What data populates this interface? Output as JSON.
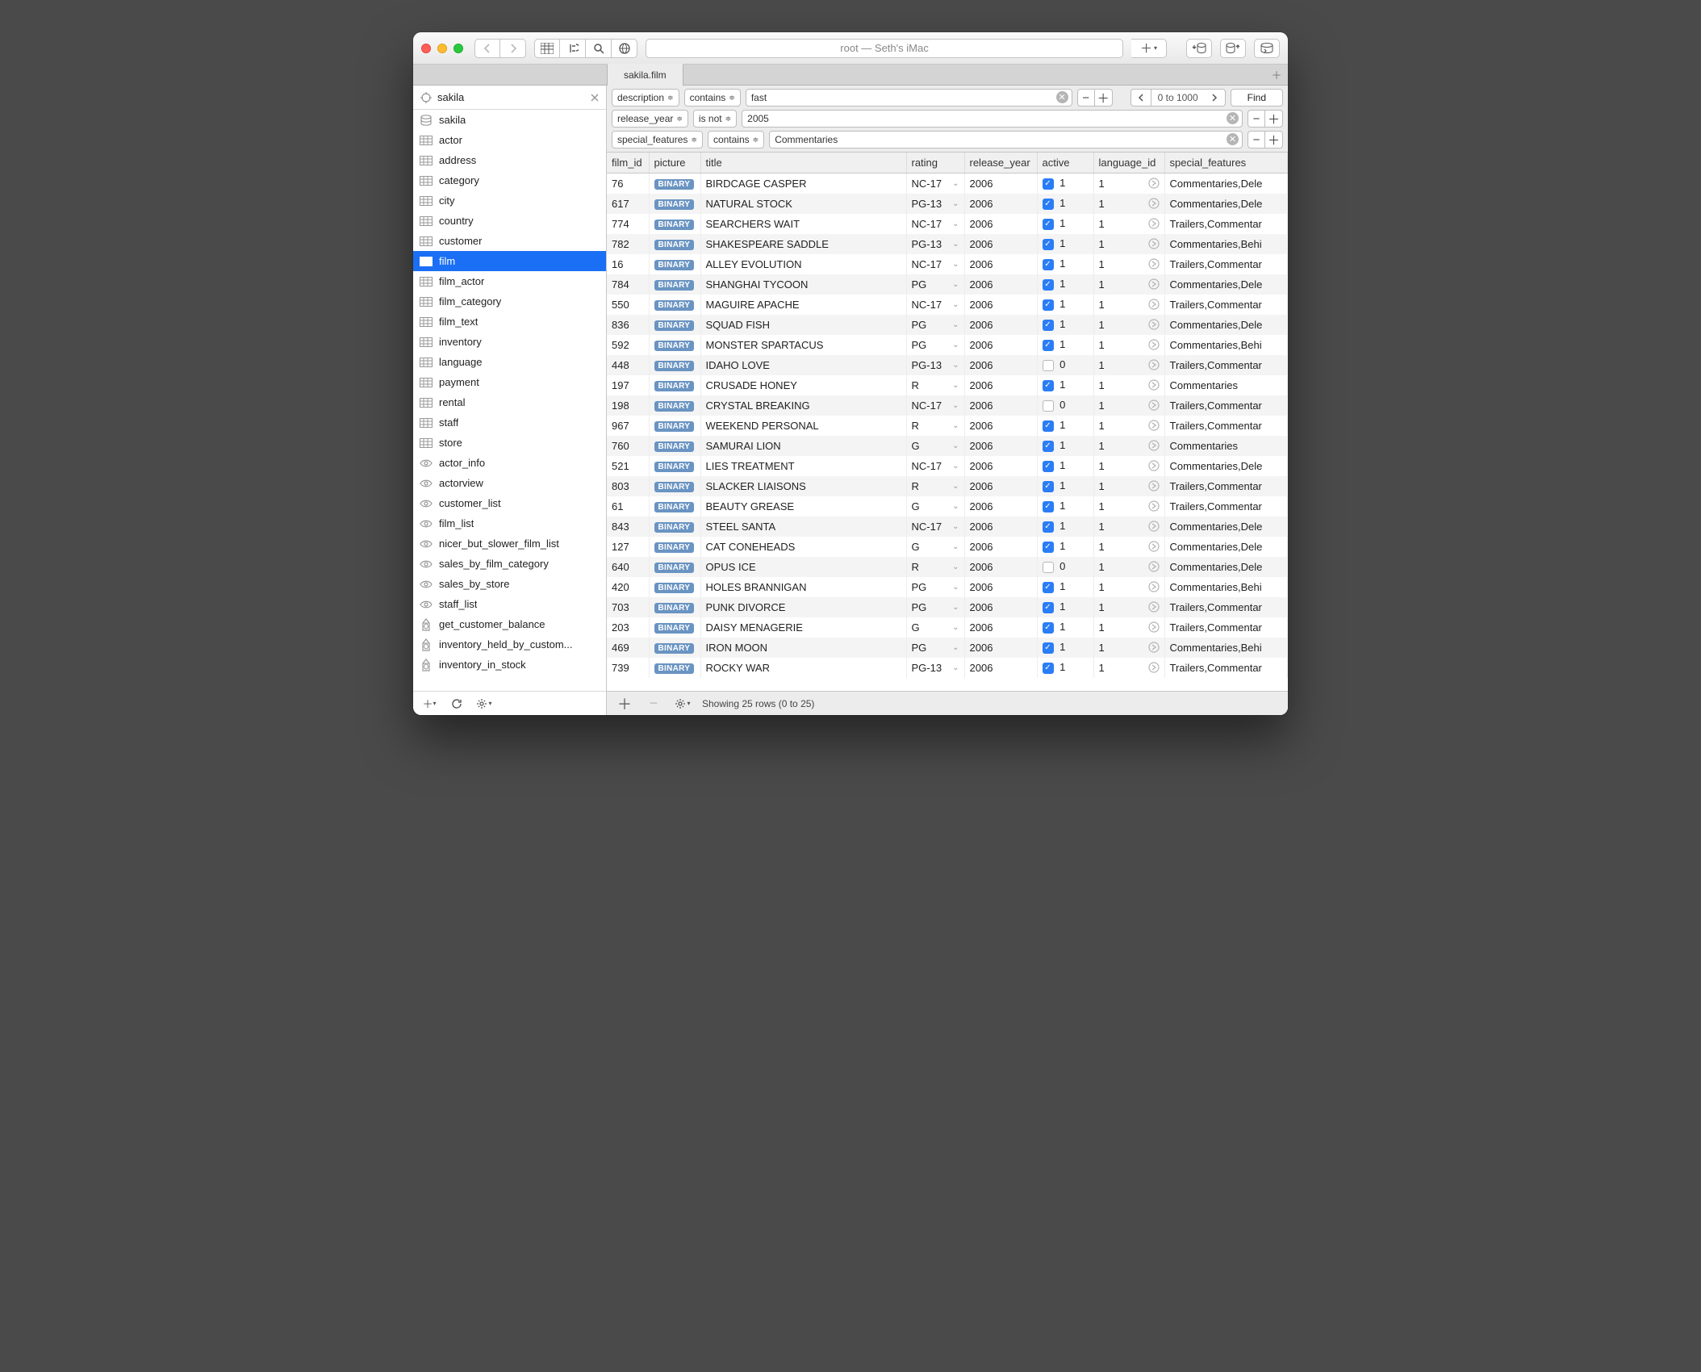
{
  "titlebar": {
    "title": "root — Seth's iMac"
  },
  "tab": {
    "label": "sakila.film"
  },
  "sidebar": {
    "search": "sakila",
    "items": [
      {
        "icon": "db",
        "label": "sakila"
      },
      {
        "icon": "table",
        "label": "actor"
      },
      {
        "icon": "table",
        "label": "address"
      },
      {
        "icon": "table",
        "label": "category"
      },
      {
        "icon": "table",
        "label": "city"
      },
      {
        "icon": "table",
        "label": "country"
      },
      {
        "icon": "table",
        "label": "customer"
      },
      {
        "icon": "table",
        "label": "film",
        "selected": true
      },
      {
        "icon": "table",
        "label": "film_actor"
      },
      {
        "icon": "table",
        "label": "film_category"
      },
      {
        "icon": "table",
        "label": "film_text"
      },
      {
        "icon": "table",
        "label": "inventory"
      },
      {
        "icon": "table",
        "label": "language"
      },
      {
        "icon": "table",
        "label": "payment"
      },
      {
        "icon": "table",
        "label": "rental"
      },
      {
        "icon": "table",
        "label": "staff"
      },
      {
        "icon": "table",
        "label": "store"
      },
      {
        "icon": "view",
        "label": "actor_info"
      },
      {
        "icon": "view",
        "label": "actorview"
      },
      {
        "icon": "view",
        "label": "customer_list"
      },
      {
        "icon": "view",
        "label": "film_list"
      },
      {
        "icon": "view",
        "label": "nicer_but_slower_film_list"
      },
      {
        "icon": "view",
        "label": "sales_by_film_category"
      },
      {
        "icon": "view",
        "label": "sales_by_store"
      },
      {
        "icon": "view",
        "label": "staff_list"
      },
      {
        "icon": "func",
        "label": "get_customer_balance"
      },
      {
        "icon": "func",
        "label": "inventory_held_by_custom..."
      },
      {
        "icon": "func",
        "label": "inventory_in_stock"
      }
    ]
  },
  "filters": [
    {
      "field": "description",
      "op": "contains",
      "value": "fast"
    },
    {
      "field": "release_year",
      "op": "is not",
      "value": "2005"
    },
    {
      "field": "special_features",
      "op": "contains",
      "value": "Commentaries"
    }
  ],
  "pager": {
    "range": "0 to 1000",
    "find_label": "Find"
  },
  "picture_label": "BINARY",
  "columns": [
    "film_id",
    "picture",
    "title",
    "rating",
    "release_year",
    "active",
    "language_id",
    "special_features"
  ],
  "rows": [
    {
      "film_id": "76",
      "title": "BIRDCAGE CASPER",
      "rating": "NC-17",
      "release_year": "2006",
      "active": true,
      "active_val": "1",
      "language_id": "1",
      "special_features": "Commentaries,Dele"
    },
    {
      "film_id": "617",
      "title": "NATURAL STOCK",
      "rating": "PG-13",
      "release_year": "2006",
      "active": true,
      "active_val": "1",
      "language_id": "1",
      "special_features": "Commentaries,Dele"
    },
    {
      "film_id": "774",
      "title": "SEARCHERS WAIT",
      "rating": "NC-17",
      "release_year": "2006",
      "active": true,
      "active_val": "1",
      "language_id": "1",
      "special_features": "Trailers,Commentar"
    },
    {
      "film_id": "782",
      "title": "SHAKESPEARE SADDLE",
      "rating": "PG-13",
      "release_year": "2006",
      "active": true,
      "active_val": "1",
      "language_id": "1",
      "special_features": "Commentaries,Behi"
    },
    {
      "film_id": "16",
      "title": "ALLEY EVOLUTION",
      "rating": "NC-17",
      "release_year": "2006",
      "active": true,
      "active_val": "1",
      "language_id": "1",
      "special_features": "Trailers,Commentar"
    },
    {
      "film_id": "784",
      "title": "SHANGHAI TYCOON",
      "rating": "PG",
      "release_year": "2006",
      "active": true,
      "active_val": "1",
      "language_id": "1",
      "special_features": "Commentaries,Dele"
    },
    {
      "film_id": "550",
      "title": "MAGUIRE APACHE",
      "rating": "NC-17",
      "release_year": "2006",
      "active": true,
      "active_val": "1",
      "language_id": "1",
      "special_features": "Trailers,Commentar"
    },
    {
      "film_id": "836",
      "title": "SQUAD FISH",
      "rating": "PG",
      "release_year": "2006",
      "active": true,
      "active_val": "1",
      "language_id": "1",
      "special_features": "Commentaries,Dele"
    },
    {
      "film_id": "592",
      "title": "MONSTER SPARTACUS",
      "rating": "PG",
      "release_year": "2006",
      "active": true,
      "active_val": "1",
      "language_id": "1",
      "special_features": "Commentaries,Behi"
    },
    {
      "film_id": "448",
      "title": "IDAHO LOVE",
      "rating": "PG-13",
      "release_year": "2006",
      "active": false,
      "active_val": "0",
      "language_id": "1",
      "special_features": "Trailers,Commentar"
    },
    {
      "film_id": "197",
      "title": "CRUSADE HONEY",
      "rating": "R",
      "release_year": "2006",
      "active": true,
      "active_val": "1",
      "language_id": "1",
      "special_features": "Commentaries"
    },
    {
      "film_id": "198",
      "title": "CRYSTAL BREAKING",
      "rating": "NC-17",
      "release_year": "2006",
      "active": false,
      "active_val": "0",
      "language_id": "1",
      "special_features": "Trailers,Commentar"
    },
    {
      "film_id": "967",
      "title": "WEEKEND PERSONAL",
      "rating": "R",
      "release_year": "2006",
      "active": true,
      "active_val": "1",
      "language_id": "1",
      "special_features": "Trailers,Commentar"
    },
    {
      "film_id": "760",
      "title": "SAMURAI LION",
      "rating": "G",
      "release_year": "2006",
      "active": true,
      "active_val": "1",
      "language_id": "1",
      "special_features": "Commentaries"
    },
    {
      "film_id": "521",
      "title": "LIES TREATMENT",
      "rating": "NC-17",
      "release_year": "2006",
      "active": true,
      "active_val": "1",
      "language_id": "1",
      "special_features": "Commentaries,Dele"
    },
    {
      "film_id": "803",
      "title": "SLACKER LIAISONS",
      "rating": "R",
      "release_year": "2006",
      "active": true,
      "active_val": "1",
      "language_id": "1",
      "special_features": "Trailers,Commentar"
    },
    {
      "film_id": "61",
      "title": "BEAUTY GREASE",
      "rating": "G",
      "release_year": "2006",
      "active": true,
      "active_val": "1",
      "language_id": "1",
      "special_features": "Trailers,Commentar"
    },
    {
      "film_id": "843",
      "title": "STEEL SANTA",
      "rating": "NC-17",
      "release_year": "2006",
      "active": true,
      "active_val": "1",
      "language_id": "1",
      "special_features": "Commentaries,Dele"
    },
    {
      "film_id": "127",
      "title": "CAT CONEHEADS",
      "rating": "G",
      "release_year": "2006",
      "active": true,
      "active_val": "1",
      "language_id": "1",
      "special_features": "Commentaries,Dele"
    },
    {
      "film_id": "640",
      "title": "OPUS ICE",
      "rating": "R",
      "release_year": "2006",
      "active": false,
      "active_val": "0",
      "language_id": "1",
      "special_features": "Commentaries,Dele"
    },
    {
      "film_id": "420",
      "title": "HOLES BRANNIGAN",
      "rating": "PG",
      "release_year": "2006",
      "active": true,
      "active_val": "1",
      "language_id": "1",
      "special_features": "Commentaries,Behi"
    },
    {
      "film_id": "703",
      "title": "PUNK DIVORCE",
      "rating": "PG",
      "release_year": "2006",
      "active": true,
      "active_val": "1",
      "language_id": "1",
      "special_features": "Trailers,Commentar"
    },
    {
      "film_id": "203",
      "title": "DAISY MENAGERIE",
      "rating": "G",
      "release_year": "2006",
      "active": true,
      "active_val": "1",
      "language_id": "1",
      "special_features": "Trailers,Commentar"
    },
    {
      "film_id": "469",
      "title": "IRON MOON",
      "rating": "PG",
      "release_year": "2006",
      "active": true,
      "active_val": "1",
      "language_id": "1",
      "special_features": "Commentaries,Behi"
    },
    {
      "film_id": "739",
      "title": "ROCKY WAR",
      "rating": "PG-13",
      "release_year": "2006",
      "active": true,
      "active_val": "1",
      "language_id": "1",
      "special_features": "Trailers,Commentar"
    }
  ],
  "status": {
    "text": "Showing 25 rows (0 to 25)"
  }
}
